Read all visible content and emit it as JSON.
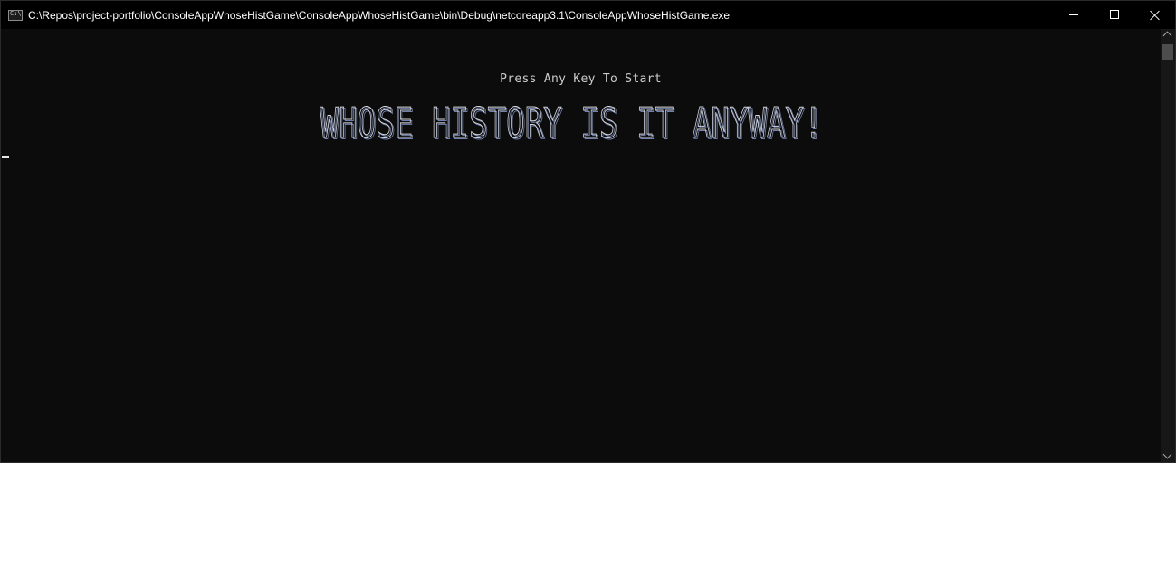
{
  "window": {
    "title": "C:\\Repos\\project-portfolio\\ConsoleAppWhoseHistGame\\ConsoleAppWhoseHistGame\\bin\\Debug\\netcoreapp3.1\\ConsoleAppWhoseHistGame.exe",
    "icon": "console-app-icon",
    "controls": {
      "minimize": "minimize-icon",
      "maximize": "maximize-icon",
      "close": "close-icon"
    }
  },
  "console": {
    "prompt": "Press Any Key To Start",
    "banner": "WHOSE HISTORY IS IT ANYWAY!",
    "text_color": "#cccccc",
    "background": "#0c0c0c"
  },
  "scrollbar": {
    "up": "chevron-up-icon",
    "down": "chevron-down-icon"
  }
}
